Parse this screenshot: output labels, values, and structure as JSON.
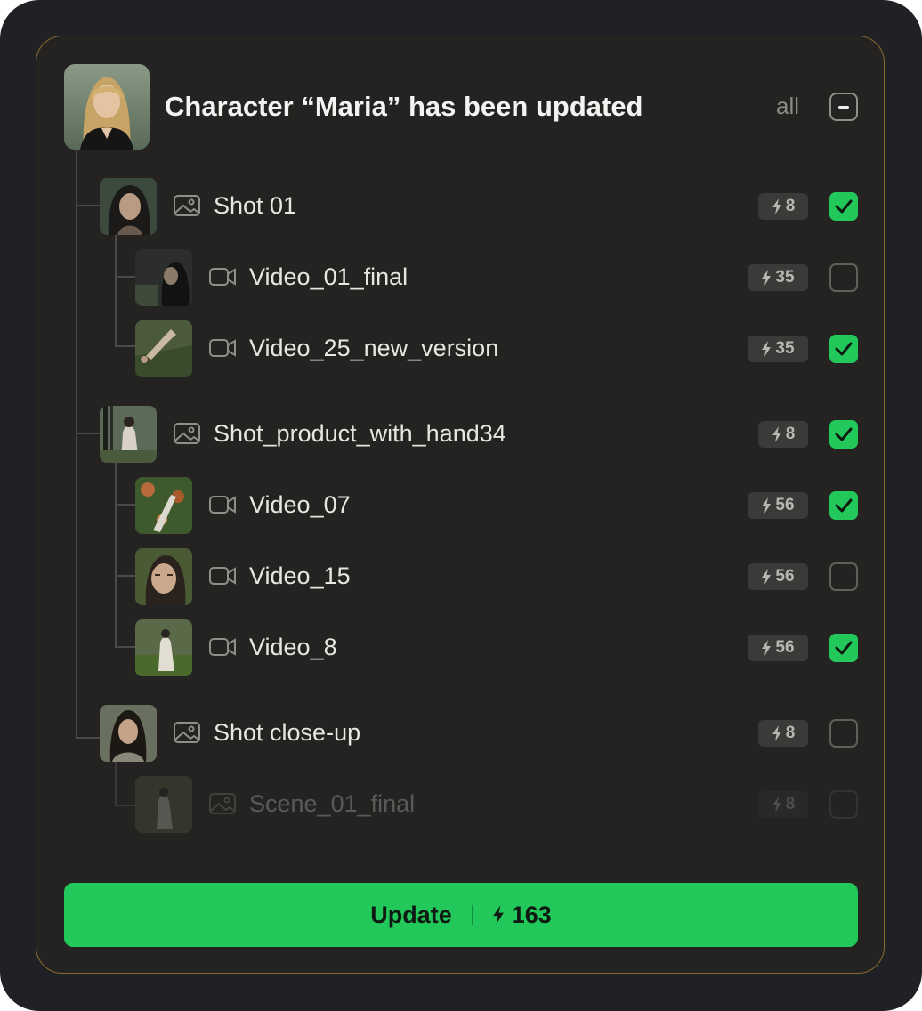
{
  "header": {
    "title": "Character “Maria” has been updated",
    "all_label": "all"
  },
  "rows": [
    {
      "label": "Shot 01",
      "type": "image",
      "cost": "8",
      "checked": true
    },
    {
      "label": "Video_01_final",
      "type": "video",
      "cost": "35",
      "checked": false
    },
    {
      "label": "Video_25_new_version",
      "type": "video",
      "cost": "35",
      "checked": true
    },
    {
      "label": "Shot_product_with_hand34",
      "type": "image",
      "cost": "8",
      "checked": true
    },
    {
      "label": "Video_07",
      "type": "video",
      "cost": "56",
      "checked": true
    },
    {
      "label": "Video_15",
      "type": "video",
      "cost": "56",
      "checked": false
    },
    {
      "label": "Video_8",
      "type": "video",
      "cost": "56",
      "checked": true
    },
    {
      "label": "Shot close-up",
      "type": "image",
      "cost": "8",
      "checked": false
    },
    {
      "label": "Scene_01_final",
      "type": "image",
      "cost": "8",
      "checked": false,
      "disabled": true
    }
  ],
  "footer": {
    "button_label": "Update",
    "total_cost": "163"
  },
  "colors": {
    "accent": "#22c95a",
    "panel_border": "#8a6a2c",
    "background": "#1f2124"
  },
  "icons": {
    "image_type": "image-icon",
    "video_type": "video-camera-icon",
    "cost": "lightning-bolt-icon",
    "check": "checkmark-icon"
  }
}
